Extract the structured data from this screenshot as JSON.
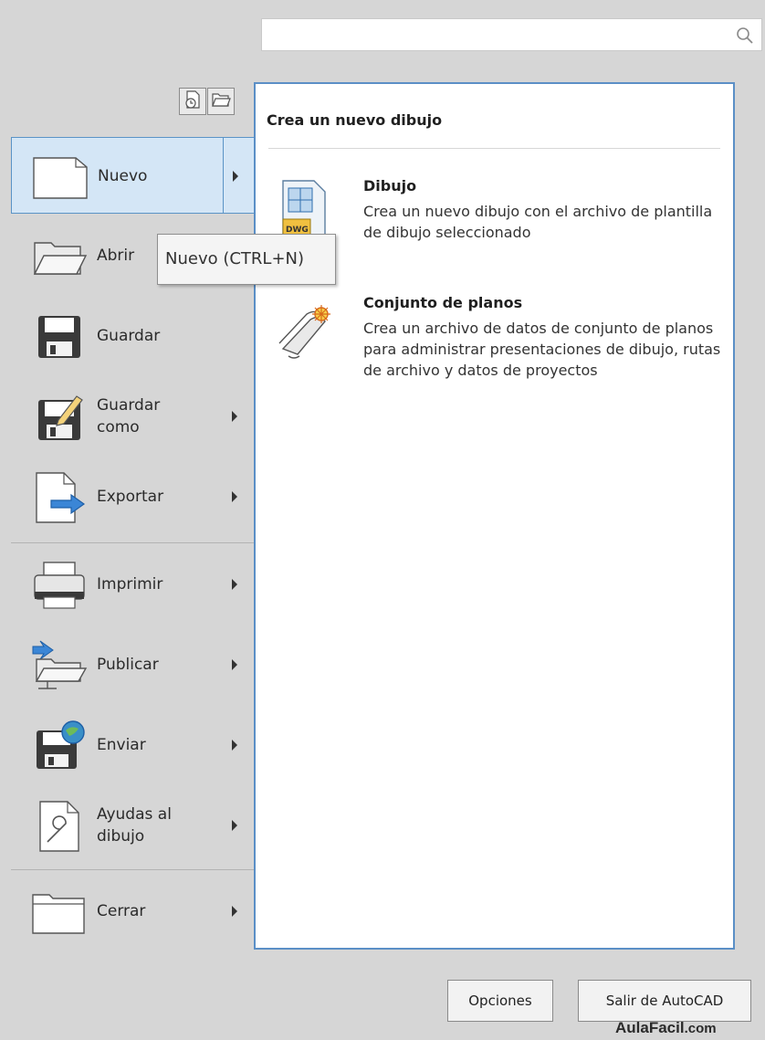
{
  "search": {
    "placeholder": "",
    "value": ""
  },
  "quick_access": {
    "recent_icon": "recent-documents-icon",
    "open_icon": "open-folder-icon"
  },
  "menu": {
    "items": [
      {
        "label": "Nuevo",
        "icon": "new-document-icon",
        "has_submenu": true,
        "active": true
      },
      {
        "label": "Abrir",
        "icon": "open-folder-icon",
        "has_submenu": false
      },
      {
        "label": "Guardar",
        "icon": "save-disk-icon",
        "has_submenu": false
      },
      {
        "label": "Guardar como",
        "icon": "save-as-icon",
        "has_submenu": true
      },
      {
        "label": "Exportar",
        "icon": "export-icon",
        "has_submenu": true
      },
      {
        "label": "Imprimir",
        "icon": "printer-icon",
        "has_submenu": true
      },
      {
        "label": "Publicar",
        "icon": "publish-icon",
        "has_submenu": true
      },
      {
        "label": "Enviar",
        "icon": "send-icon",
        "has_submenu": true
      },
      {
        "label": "Ayudas al dibujo",
        "icon": "drawing-utilities-icon",
        "has_submenu": true
      },
      {
        "label": "Cerrar",
        "icon": "close-folder-icon",
        "has_submenu": true
      }
    ],
    "labels": {
      "nuevo": "Nuevo",
      "abrir": "Abrir",
      "guardar": "Guardar",
      "guardar_como_1": "Guardar",
      "guardar_como_2": "como",
      "exportar": "Exportar",
      "imprimir": "Imprimir",
      "publicar": "Publicar",
      "enviar": "Enviar",
      "ayudas_1": "Ayudas al",
      "ayudas_2": "dibujo",
      "cerrar": "Cerrar"
    }
  },
  "tooltip": {
    "text": "Nuevo (CTRL+N)"
  },
  "panel": {
    "title": "Crea un nuevo dibujo",
    "entries": [
      {
        "title": "Dibujo",
        "description": "Crea un nuevo dibujo con el archivo de plantilla de dibujo seleccionado",
        "icon": "dwg-file-icon"
      },
      {
        "title": "Conjunto de planos",
        "description": "Crea un archivo de datos de conjunto de planos para administrar presentaciones de dibujo, rutas de archivo y datos de proyectos",
        "icon": "sheet-set-icon"
      }
    ]
  },
  "footer": {
    "options_label": "Opciones",
    "exit_label": "Salir de AutoCAD"
  },
  "watermark": {
    "brand": "AulaFacil",
    "suffix": ".com"
  },
  "colors": {
    "accent_border": "#5b8fc6",
    "active_bg": "#d4e6f6",
    "menu_bg": "#d6d6d6"
  }
}
